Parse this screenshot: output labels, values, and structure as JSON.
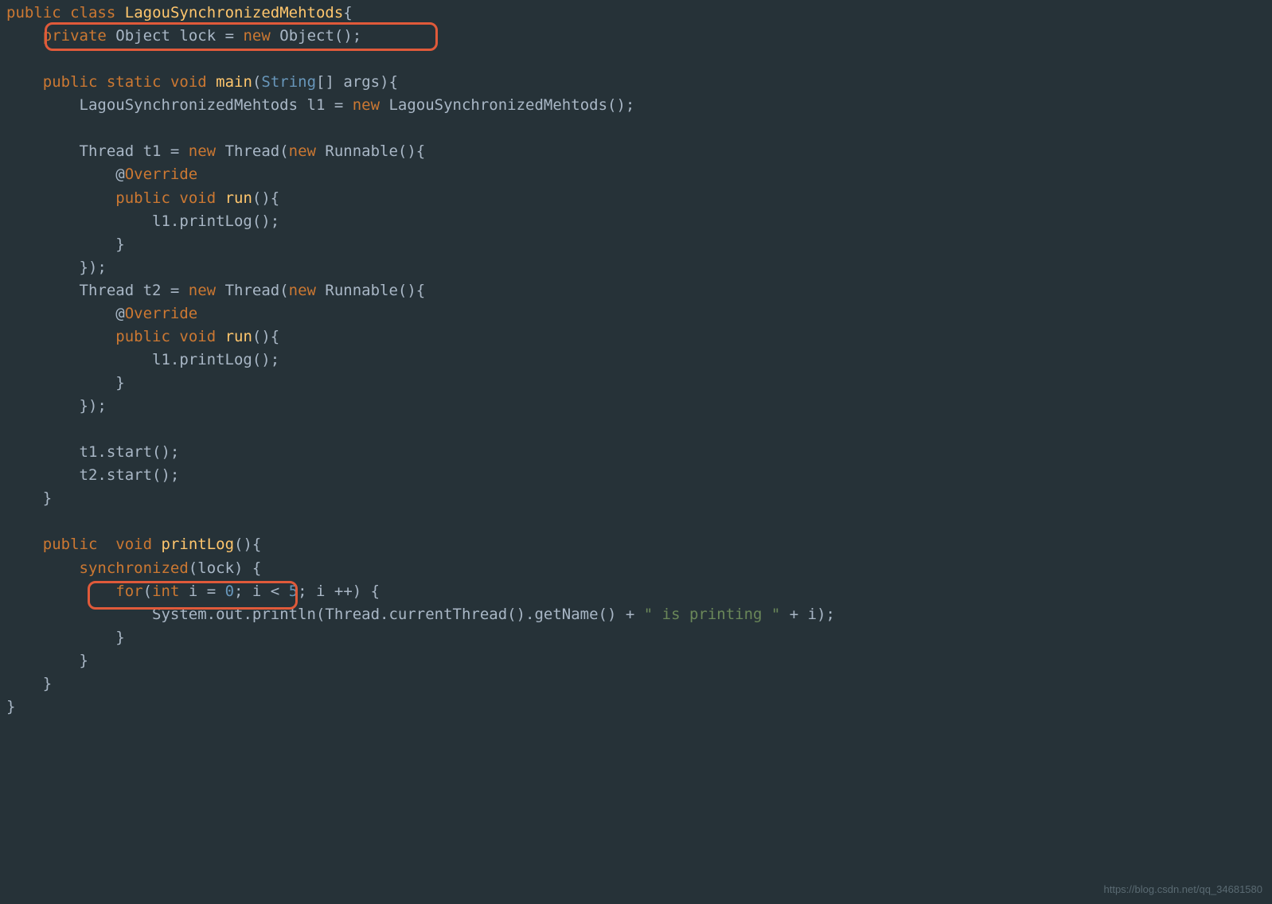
{
  "code": {
    "l1": {
      "kw1": "public",
      "kw2": "class",
      "cls": "LagouSynchronizedMehtods",
      "brace": "{"
    },
    "l2": {
      "indent": "    ",
      "kw1": "private",
      "type": "Object",
      "var": "lock",
      "eq": " = ",
      "kw2": "new",
      "ctor": "Object",
      "paren": "();"
    },
    "l4": {
      "indent": "    ",
      "kw1": "public",
      "kw2": "static",
      "kw3": "void",
      "method": "main",
      "lp": "(",
      "ptype": "String",
      "arr": "[]",
      "param": " args",
      "rp": ")",
      "brace": "{"
    },
    "l5": {
      "indent": "        ",
      "type": "LagouSynchronizedMehtods",
      "var": " l1 = ",
      "kw": "new",
      "ctor": " LagouSynchronizedMehtods();"
    },
    "l7": {
      "indent": "        ",
      "type": "Thread",
      "var": " t1 = ",
      "kw1": "new",
      "ctor1": " Thread(",
      "kw2": "new",
      "ctor2": " Runnable(){"
    },
    "l8": {
      "indent": "            ",
      "at": "@",
      "ann": "Override"
    },
    "l9": {
      "indent": "            ",
      "kw1": "public",
      "kw2": "void",
      "method": "run",
      "rest": "(){"
    },
    "l10": {
      "indent": "                ",
      "text": "l1.printLog();"
    },
    "l11": {
      "indent": "            ",
      "text": "}"
    },
    "l12": {
      "indent": "        ",
      "text": "});"
    },
    "l13": {
      "indent": "        ",
      "type": "Thread",
      "var": " t2 = ",
      "kw1": "new",
      "ctor1": " Thread(",
      "kw2": "new",
      "ctor2": " Runnable(){"
    },
    "l14": {
      "indent": "            ",
      "at": "@",
      "ann": "Override"
    },
    "l15": {
      "indent": "            ",
      "kw1": "public",
      "kw2": "void",
      "method": "run",
      "rest": "(){"
    },
    "l16": {
      "indent": "                ",
      "text": "l1.printLog();"
    },
    "l17": {
      "indent": "            ",
      "text": "}"
    },
    "l18": {
      "indent": "        ",
      "text": "});"
    },
    "l20": {
      "indent": "        ",
      "text": "t1.start();"
    },
    "l21": {
      "indent": "        ",
      "text": "t2.start();"
    },
    "l22": {
      "indent": "    ",
      "text": "}"
    },
    "l24": {
      "indent": "    ",
      "kw1": "public",
      "sp": "  ",
      "kw2": "void",
      "method": "printLog",
      "rest": "(){"
    },
    "l25": {
      "indent": "        ",
      "kw": "synchronized",
      "lp": "(",
      "var": "lock",
      "rp": ")",
      "brace": " {"
    },
    "l26": {
      "indent": "            ",
      "kw": "for",
      "lp": "(",
      "kwint": "int",
      "var": " i = ",
      "num1": "0",
      "semi1": "; i < ",
      "num2": "5",
      "semi2": "; i ++) {"
    },
    "l27": {
      "indent": "                ",
      "txt1": "System.",
      "out": "out",
      "txt2": ".println(Thread.currentThread().getName() + ",
      "str": "\" is printing \"",
      "txt3": " + i);"
    },
    "l28": {
      "indent": "            ",
      "text": "}"
    },
    "l29": {
      "indent": "        ",
      "text": "}"
    },
    "l30": {
      "indent": "    ",
      "text": "}"
    },
    "l31": {
      "text": "}"
    }
  },
  "watermark": "https://blog.csdn.net/qq_34681580"
}
